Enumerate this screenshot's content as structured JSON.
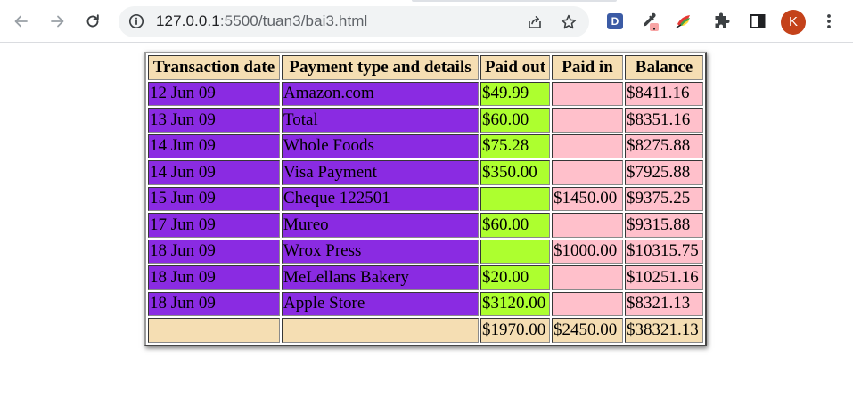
{
  "browser": {
    "url_host": "127.0.0.1",
    "url_path": ":5500/tuan3/bai3.html",
    "extensions": [
      "dark-reader-icon",
      "eyedropper-icon",
      "colorful-extension-icon",
      "puzzle-extensions-icon",
      "side-panel-icon"
    ],
    "extension_d_label": "D",
    "profile_initial": "K"
  },
  "table": {
    "headers": {
      "date": "Transaction date",
      "desc": "Payment type and details",
      "out": "Paid out",
      "in": "Paid in",
      "bal": "Balance"
    },
    "rows": [
      {
        "date": "12 Jun 09",
        "desc": "Amazon.com",
        "out": "$49.99",
        "in": "",
        "bal": "$8411.16"
      },
      {
        "date": "13 Jun 09",
        "desc": "Total",
        "out": "$60.00",
        "in": "",
        "bal": "$8351.16"
      },
      {
        "date": "14 Jun 09",
        "desc": "Whole Foods",
        "out": "$75.28",
        "in": "",
        "bal": "$8275.88"
      },
      {
        "date": "14 Jun 09",
        "desc": "Visa Payment",
        "out": "$350.00",
        "in": "",
        "bal": "$7925.88"
      },
      {
        "date": "15 Jun 09",
        "desc": "Cheque 122501",
        "out": "",
        "in": "$1450.00",
        "bal": "$9375.25"
      },
      {
        "date": "17 Jun 09",
        "desc": "Mureo",
        "out": "$60.00",
        "in": "",
        "bal": "$9315.88"
      },
      {
        "date": "18 Jun 09",
        "desc": "Wrox Press",
        "out": "",
        "in": "$1000.00",
        "bal": "$10315.75"
      },
      {
        "date": "18 Jun 09",
        "desc": "MeLellans Bakery",
        "out": "$20.00",
        "in": "",
        "bal": "$10251.16"
      },
      {
        "date": "18 Jun 09",
        "desc": "Apple Store",
        "out": "$3120.00",
        "in": "",
        "bal": "$8321.13"
      }
    ],
    "totals": {
      "date": "",
      "desc": "",
      "out": "$1970.00",
      "in": "$2450.00",
      "bal": "$38321.13"
    }
  },
  "colors": {
    "header_bg": "#f5deb3",
    "date_desc_bg": "#8a2be2",
    "paid_out_bg": "#adff2f",
    "paid_in_balance_bg": "#ffc0cb",
    "avatar_bg": "#c4421a"
  }
}
